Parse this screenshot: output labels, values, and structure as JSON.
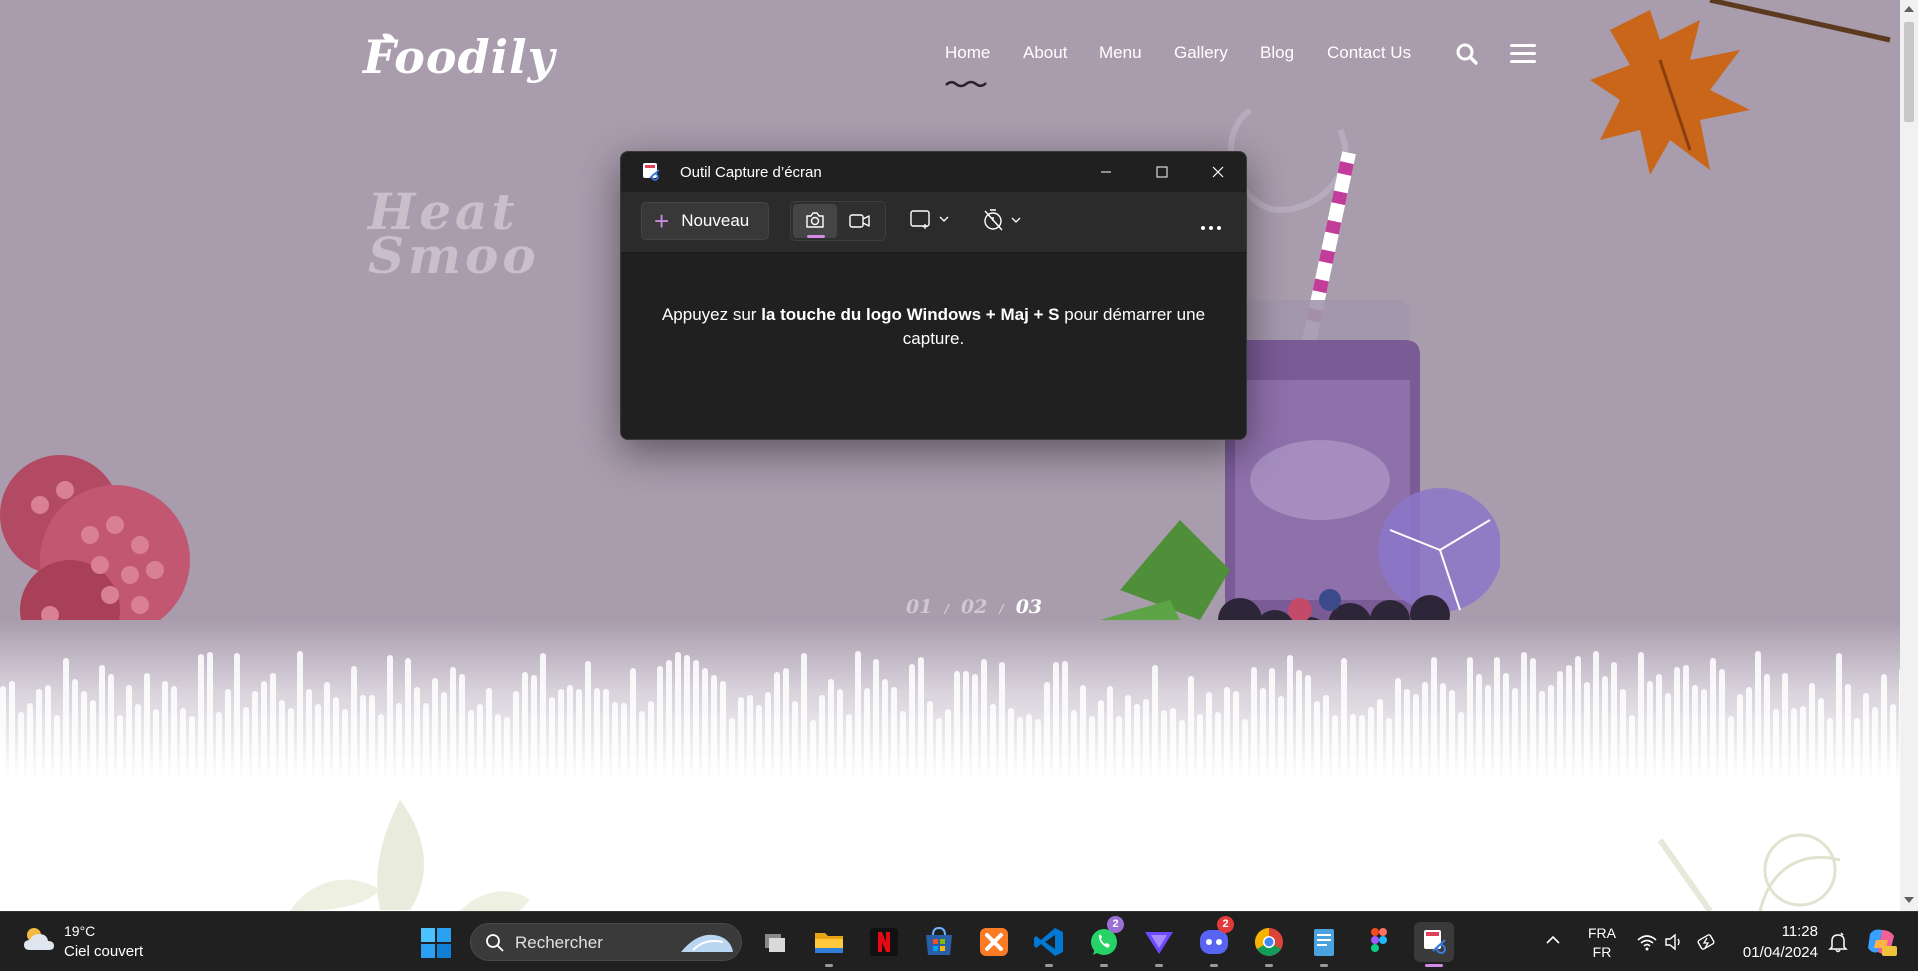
{
  "site": {
    "logo": "Foodily",
    "nav": [
      "Home",
      "About",
      "Menu",
      "Gallery",
      "Blog",
      "Contact Us"
    ],
    "active_nav": "Home",
    "hero_title_line1": "Heat",
    "hero_title_line2": "Smoo",
    "slides": [
      "01",
      "02",
      "03"
    ],
    "active_slide": "03",
    "colors": {
      "hero_bg": "#a89cad",
      "accent": "#d28ae8"
    }
  },
  "snip": {
    "title": "Outil Capture d’écran",
    "new_button": "Nouveau",
    "icons": [
      "camera-icon",
      "video-icon",
      "rectangle-mode-icon",
      "timer-off-icon",
      "more-icon"
    ],
    "message_before": "Appuyez sur ",
    "message_bold": "la touche du logo Windows + Maj + S",
    "message_after": " pour démarrer une capture."
  },
  "taskbar": {
    "weather_temp": "19°C",
    "weather_desc": "Ciel couvert",
    "search_placeholder": "Rechercher",
    "apps": [
      "task-view",
      "file-explorer",
      "netflix",
      "microsoft-store",
      "xampp",
      "vscode",
      "whatsapp",
      "proton-vpn",
      "discord",
      "chrome",
      "notepad",
      "figma",
      "snipping-tool"
    ],
    "whatsapp_badge": "2",
    "discord_badge": "2",
    "lang_line1": "FRA",
    "lang_line2": "FR",
    "time": "11:28",
    "date": "01/04/2024"
  }
}
